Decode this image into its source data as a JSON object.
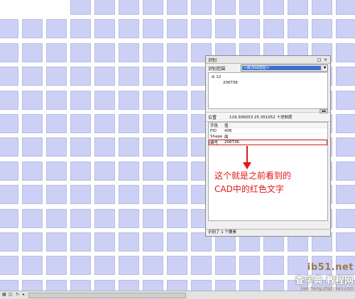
{
  "identify_panel": {
    "title": "识别",
    "title_buttons": [
      "□",
      "×"
    ],
    "identify_from_label": "识别范围",
    "identify_from_value": "<最顶部图层>",
    "tree": {
      "layer": "12",
      "feature": "206T36"
    },
    "location_label": "位置",
    "location_value": "119.306053  25.351052 十进制度",
    "table": {
      "header": {
        "field": "字段",
        "value": "值"
      },
      "rows": [
        {
          "field": "FID",
          "value": "406"
        },
        {
          "field": "Shape",
          "value": "面"
        },
        {
          "field": "编号",
          "value": "206T36",
          "highlighted": true
        }
      ]
    },
    "status": "识别了 1 个要素"
  },
  "annotation": {
    "line1": "这个就是之前看到的",
    "line2": "CAD中的红色文字",
    "color": "#e21616"
  },
  "watermark": {
    "line1": "ib51.net",
    "line2": "查字典 教程网",
    "line3": "jiaocheng.chazidian.com"
  },
  "colors": {
    "tile_fill": "#cdd0f5",
    "tile_border": "#b9bde6",
    "highlight": "#d32020"
  }
}
